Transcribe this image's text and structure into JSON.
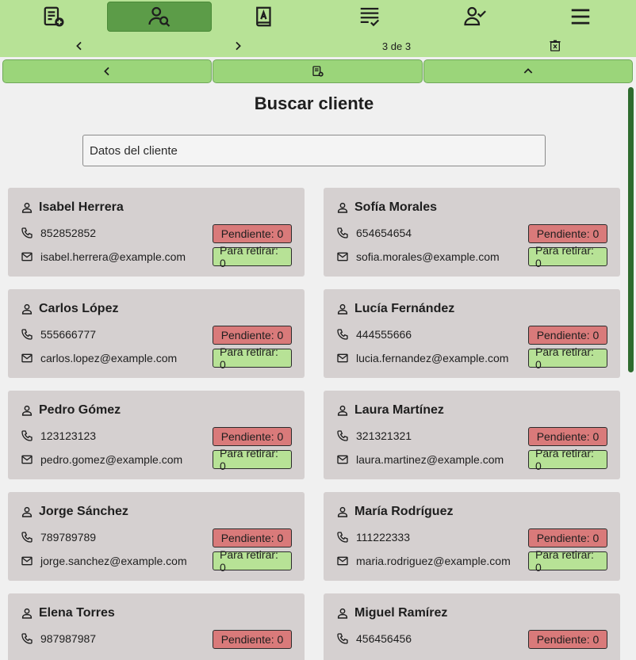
{
  "nav": {
    "items": [
      {
        "name": "new-order-icon"
      },
      {
        "name": "search-client-icon",
        "active": true
      },
      {
        "name": "address-book-icon"
      },
      {
        "name": "order-list-icon"
      },
      {
        "name": "user-check-icon"
      },
      {
        "name": "menu-icon"
      }
    ]
  },
  "pager": {
    "label": "3 de 3"
  },
  "page": {
    "title": "Buscar cliente",
    "search_placeholder": "Datos del cliente"
  },
  "clients": [
    {
      "name": "Isabel Herrera",
      "phone": "852852852",
      "email": "isabel.herrera@example.com",
      "pending": "Pendiente: 0",
      "ready": "Para retirar: 0"
    },
    {
      "name": "Sofía Morales",
      "phone": "654654654",
      "email": "sofia.morales@example.com",
      "pending": "Pendiente: 0",
      "ready": "Para retirar: 0"
    },
    {
      "name": "Carlos López",
      "phone": "555666777",
      "email": "carlos.lopez@example.com",
      "pending": "Pendiente: 0",
      "ready": "Para retirar: 0"
    },
    {
      "name": "Lucía Fernández",
      "phone": "444555666",
      "email": "lucia.fernandez@example.com",
      "pending": "Pendiente: 0",
      "ready": "Para retirar: 0"
    },
    {
      "name": "Pedro Gómez",
      "phone": "123123123",
      "email": "pedro.gomez@example.com",
      "pending": "Pendiente: 0",
      "ready": "Para retirar: 0"
    },
    {
      "name": "Laura Martínez",
      "phone": "321321321",
      "email": "laura.martinez@example.com",
      "pending": "Pendiente: 0",
      "ready": "Para retirar: 0"
    },
    {
      "name": "Jorge Sánchez",
      "phone": "789789789",
      "email": "jorge.sanchez@example.com",
      "pending": "Pendiente: 0",
      "ready": "Para retirar: 0"
    },
    {
      "name": "María Rodríguez",
      "phone": "111222333",
      "email": "maria.rodriguez@example.com",
      "pending": "Pendiente: 0",
      "ready": "Para retirar: 0"
    },
    {
      "name": "Elena Torres",
      "phone": "987987987",
      "email": "",
      "pending": "Pendiente: 0",
      "ready": ""
    },
    {
      "name": "Miguel Ramírez",
      "phone": "456456456",
      "email": "",
      "pending": "Pendiente: 0",
      "ready": ""
    }
  ],
  "colors": {
    "topbar": "#b7e296",
    "active_tab": "#5c9c48",
    "pending_badge": "#d97a7a",
    "ready_badge": "#b7e296",
    "card": "#d5d0d0"
  }
}
